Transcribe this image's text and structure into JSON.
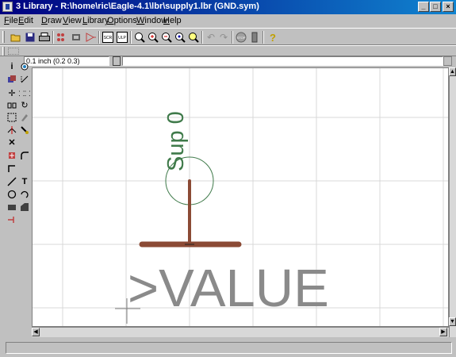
{
  "window": {
    "title": "3 Library - R:\\home\\ric\\Eagle-4.1\\lbr\\supply1.lbr (GND.sym)",
    "minimize": "_",
    "maximize": "□",
    "close": "×"
  },
  "menu": {
    "file": {
      "first": "F",
      "rest": "ile"
    },
    "edit": {
      "first": "E",
      "rest": "dit"
    },
    "draw": {
      "first": "D",
      "rest": "raw"
    },
    "view": {
      "first": "V",
      "rest": "iew"
    },
    "library": {
      "first": "L",
      "rest": "ibrary"
    },
    "options": {
      "first": "O",
      "rest": "ptions"
    },
    "window": {
      "first": "W",
      "rest": "indow"
    },
    "help": {
      "first": "H",
      "rest": "elp"
    }
  },
  "toolbar": {
    "script_label": "SCR",
    "ulp_label": "ULP",
    "stop_label": "STOP",
    "help_glyph": "?"
  },
  "coordinate": {
    "readout": "0.1 inch (0.2 0.3)"
  },
  "command_line": {
    "value": ""
  },
  "symbol": {
    "name_text": "Sup 0",
    "value_text": ">VALUE"
  },
  "status": {
    "text": ""
  },
  "colors": {
    "title_start": "#000080",
    "title_end": "#1084d0",
    "symbol_pin": "#8b4a35",
    "name_text": "#3f7a4a",
    "value_text": "#8a8a8a",
    "grid": "#d8d8d8",
    "origin_circle": "#3f7a4a"
  }
}
